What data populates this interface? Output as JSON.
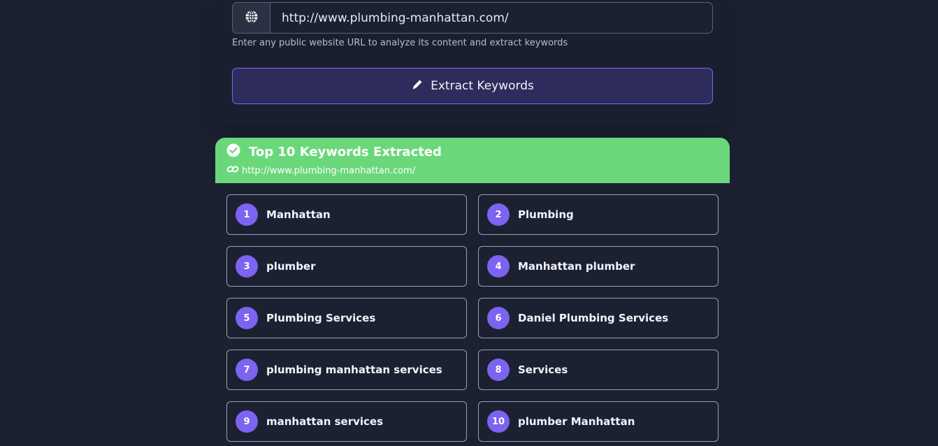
{
  "form": {
    "url_value": "http://www.plumbing-manhattan.com/",
    "hint": "Enter any public website URL to analyze its content and extract keywords",
    "extract_label": "Extract Keywords",
    "globe_icon": "globe-icon",
    "pencil_icon": "pencil-icon"
  },
  "result": {
    "title": "Top 10 Keywords Extracted",
    "url": "http://www.plumbing-manhattan.com/",
    "check_icon": "check-circle-icon",
    "link_icon": "link-icon",
    "header_color": "#6ad87a",
    "badge_color": "#7c63f0"
  },
  "keywords": [
    {
      "rank": "1",
      "text": "Manhattan"
    },
    {
      "rank": "2",
      "text": "Plumbing"
    },
    {
      "rank": "3",
      "text": "plumber"
    },
    {
      "rank": "4",
      "text": "Manhattan plumber"
    },
    {
      "rank": "5",
      "text": "Plumbing Services"
    },
    {
      "rank": "6",
      "text": "Daniel Plumbing Services"
    },
    {
      "rank": "7",
      "text": "plumbing manhattan services"
    },
    {
      "rank": "8",
      "text": "Services"
    },
    {
      "rank": "9",
      "text": "manhattan services"
    },
    {
      "rank": "10",
      "text": "plumber Manhattan"
    }
  ]
}
